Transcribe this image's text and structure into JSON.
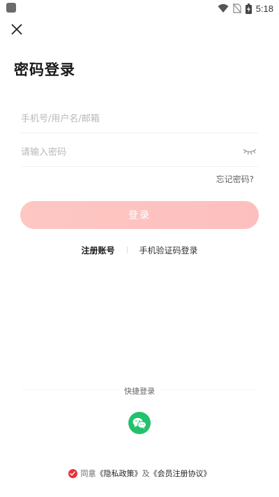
{
  "status_bar": {
    "time": "5:18"
  },
  "header": {
    "close_icon": "close-icon",
    "title": "密码登录"
  },
  "form": {
    "account_placeholder": "手机号/用户名/邮箱",
    "password_placeholder": "请输入密码",
    "password_toggle_icon": "eye-closed-icon",
    "forgot_label": "忘记密码?",
    "login_label": "登录"
  },
  "alt_actions": {
    "register_label": "注册账号",
    "sms_login_label": "手机验证码登录"
  },
  "quick_login": {
    "label": "快捷登录",
    "wechat_icon": "wechat-icon"
  },
  "agreement": {
    "prefix": "同意",
    "privacy_link": "《隐私政策》",
    "conjunction": "及",
    "member_link": "《会员注册协议》"
  },
  "colors": {
    "login_button": "#fdc4c0",
    "wechat": "#22c26d",
    "agree_check": "#e8323c"
  }
}
